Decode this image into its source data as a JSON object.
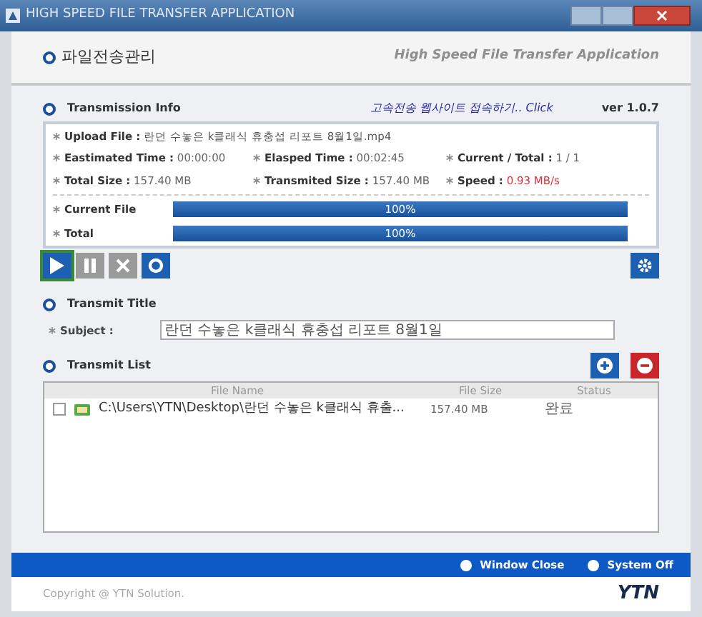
{
  "window": {
    "title": "HIGH SPEED FILE TRANSFER APPLICATION"
  },
  "header": {
    "title": "파일전송관리",
    "subtitle": "High Speed File Transfer Application"
  },
  "transmission_info": {
    "title": "Transmission Info",
    "link": "고속전송 웹사이트 접속하기.. Click",
    "version": "ver 1.0.7",
    "upload_file": {
      "label": "Upload File :",
      "value": "란던 수놓은 k클래식 휴충섭 리포트 8월1일.mp4"
    },
    "fields": [
      {
        "label": "Eastimated Time :",
        "value": "00:00:00",
        "alert": false
      },
      {
        "label": "Elasped Time :",
        "value": "00:02:45",
        "alert": false
      },
      {
        "label": "Current / Total :",
        "value": "1 / 1",
        "alert": false
      },
      {
        "label": "Total Size :",
        "value": "157.40 MB",
        "alert": false
      },
      {
        "label": "Transmited Size :",
        "value": "157.40 MB",
        "alert": false
      },
      {
        "label": "Speed :",
        "value": "0.93 MB/s",
        "alert": true
      }
    ],
    "progress": [
      {
        "label": "Current File",
        "level": 1,
        "reading": "100%"
      },
      {
        "label": "Total",
        "level": 1,
        "reading": "100%"
      }
    ]
  },
  "controls": [
    {
      "kind": "play",
      "disabled": false
    },
    {
      "kind": "pause",
      "disabled": true
    },
    {
      "kind": "stop",
      "disabled": true
    },
    {
      "kind": "refresh",
      "disabled": false
    }
  ],
  "transmit_title": {
    "title": "Transmit Title",
    "subject_label": "Subject :",
    "subject": "란던 수놓은 k클래식 휴충섭 리포트 8월1일"
  },
  "transmit_list": {
    "title": "Transmit List",
    "columns": [
      "File Name",
      "File Size",
      "Status"
    ],
    "rows": [
      {
        "checked": false,
        "file": "C:\\Users\\YTN\\Desktop\\란던 수놓은 k클래식 휴출...",
        "size": "157.40 MB",
        "status": "완료"
      }
    ]
  },
  "footer": {
    "buttons": [
      "Window Close",
      "System Off"
    ],
    "copyright": "Copyright @ YTN Solution.",
    "logo": "YTN"
  }
}
